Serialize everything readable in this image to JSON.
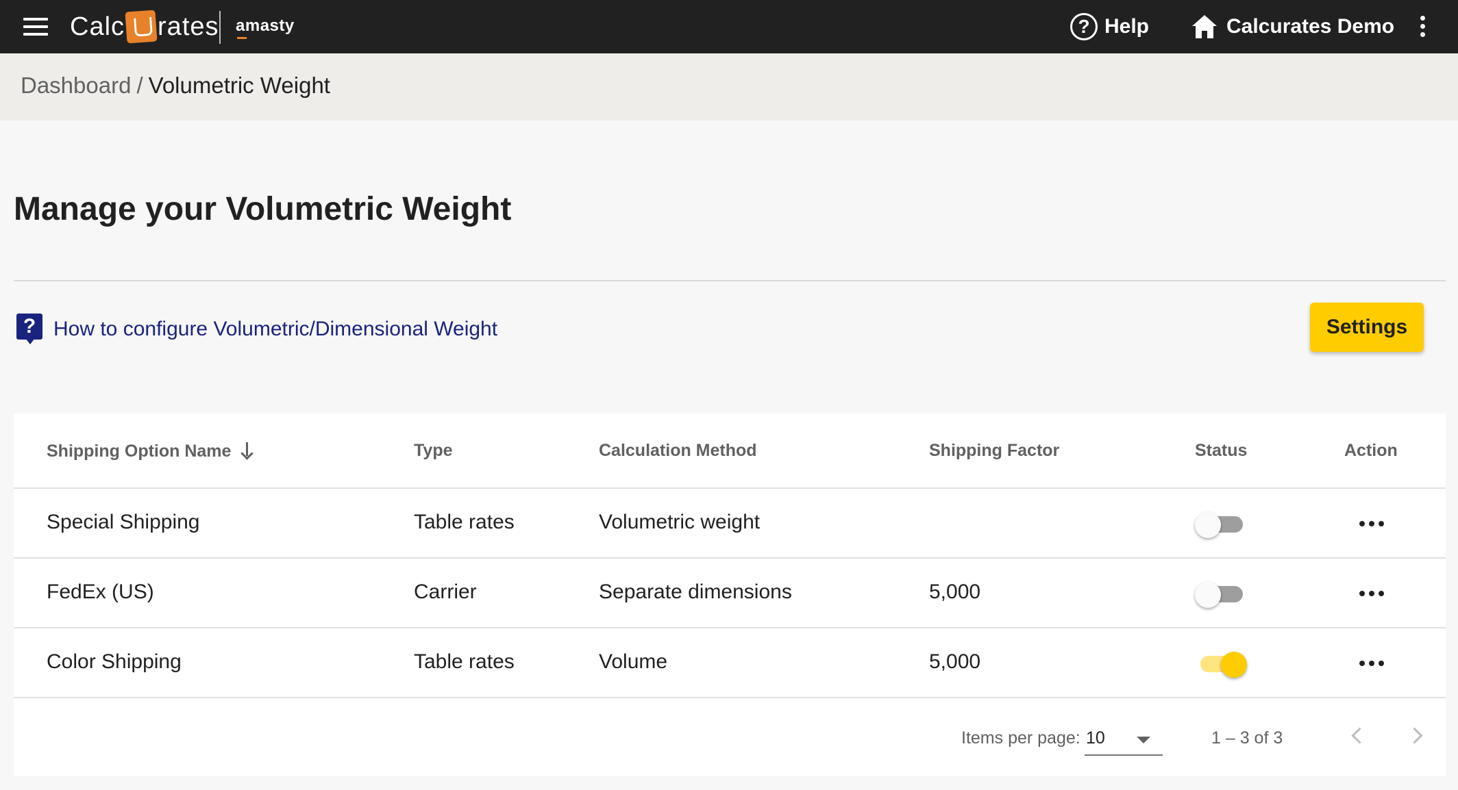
{
  "header": {
    "logo_prefix": "Calc",
    "logo_suffix": "rates",
    "partner": "amasty",
    "help_label": "Help",
    "store_label": "Calcurates Demo"
  },
  "breadcrumb": {
    "parent": "Dashboard",
    "separator": "/",
    "current": "Volumetric Weight"
  },
  "page": {
    "title": "Manage your Volumetric Weight",
    "help_link": "How to configure Volumetric/Dimensional Weight",
    "help_link_icon": "question-box-icon",
    "settings_label": "Settings"
  },
  "table": {
    "columns": {
      "name": "Shipping Option Name",
      "type": "Type",
      "method": "Calculation Method",
      "factor": "Shipping Factor",
      "status": "Status",
      "action": "Action"
    },
    "rows": [
      {
        "name": "Special Shipping",
        "type": "Table rates",
        "method": "Volumetric weight",
        "factor": "",
        "status": "off"
      },
      {
        "name": "FedEx (US)",
        "type": "Carrier",
        "method": "Separate dimensions",
        "factor": "5,000",
        "status": "off"
      },
      {
        "name": "Color Shipping",
        "type": "Table rates",
        "method": "Volume",
        "factor": "5,000",
        "status": "on"
      }
    ]
  },
  "paginator": {
    "items_per_page_label": "Items per page:",
    "items_per_page_value": "10",
    "range_label": "1 – 3 of 3"
  },
  "colors": {
    "topbar": "#212121",
    "accent": "#ffcc00",
    "link": "#1a237e",
    "logo_orange": "#e8822a"
  }
}
